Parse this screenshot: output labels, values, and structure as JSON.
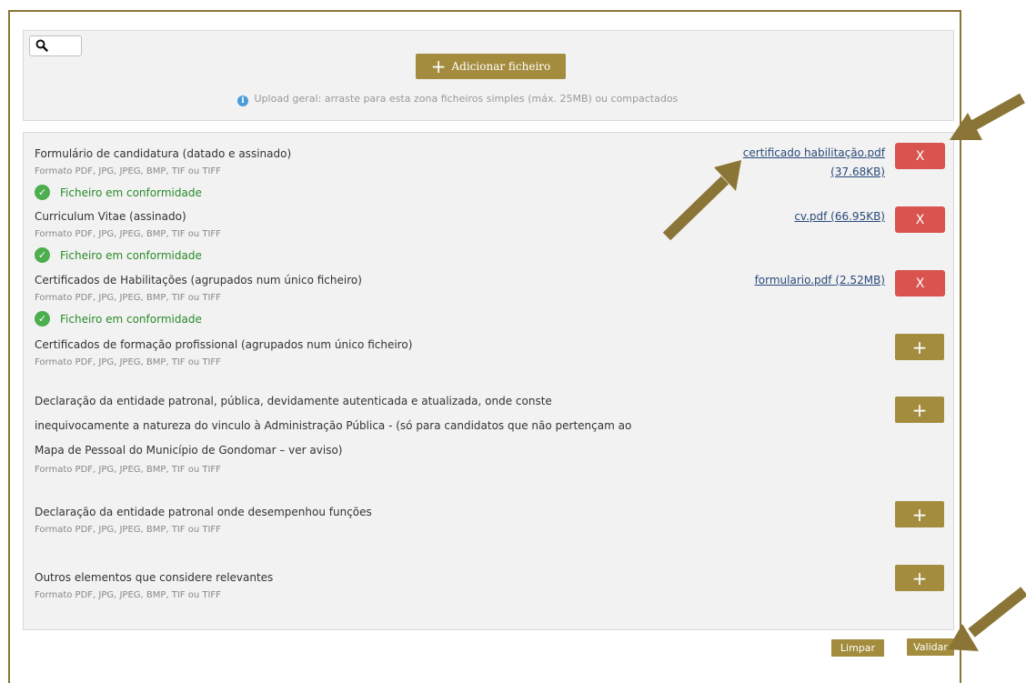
{
  "upload": {
    "add_file_label": "Adicionar ficheiro",
    "info_text": "Upload geral: arraste para esta zona ficheiros simples (máx. 25MB) ou compactados"
  },
  "documents": [
    {
      "label": "Formulário de candidatura (datado e assinado)",
      "format": "Formato PDF, JPG, JPEG, BMP, TIF ou TIFF",
      "file_name": "certificado habilitação.pdf",
      "file_size": "(37.68KB)",
      "status": "Ficheiro em conformidade",
      "delete_label": "X"
    },
    {
      "label": "Curriculum Vitae (assinado)",
      "format": "Formato PDF, JPG, JPEG, BMP, TIF ou TIFF",
      "file_link": "cv.pdf (66.95KB)",
      "status": "Ficheiro em conformidade",
      "delete_label": "X"
    },
    {
      "label": "Certificados de Habilitações (agrupados num único ficheiro)",
      "format": "Formato PDF, JPG, JPEG, BMP, TIF ou TIFF",
      "file_link": "formulario.pdf (2.52MB)",
      "status": "Ficheiro em conformidade",
      "delete_label": "X"
    },
    {
      "label": "Certificados de formação profissional (agrupados num único ficheiro)",
      "format": "Formato PDF, JPG, JPEG, BMP, TIF ou TIFF",
      "add_label": "+"
    },
    {
      "label_lines": [
        "Declaração da entidade patronal, pública, devidamente autenticada e atualizada, onde conste",
        "inequivocamente a natureza do vinculo à Administração Pública - (só para candidatos que não pertençam ao",
        "Mapa de Pessoal do Município de Gondomar – ver aviso)"
      ],
      "format": "Formato PDF, JPG, JPEG, BMP, TIF ou TIFF",
      "add_label": "+"
    },
    {
      "label": "Declaração da entidade patronal onde desempenhou funções",
      "format": "Formato PDF, JPG, JPEG, BMP, TIF ou TIFF",
      "add_label": "+"
    },
    {
      "label": "Outros elementos que considere relevantes",
      "format": "Formato PDF, JPG, JPEG, BMP, TIF ou TIFF",
      "add_label": "+"
    }
  ],
  "actions": {
    "clear_label": "Limpar",
    "validate_label": "Validar"
  },
  "icons": {
    "search": "search-icon",
    "info": "info-icon",
    "check": "check-circle-icon",
    "plus": "plus-icon"
  },
  "colors": {
    "accent_gold": "#a48c3e",
    "danger_red": "#d9534f",
    "success_green": "#4cae4c",
    "info_blue": "#4a9bd9",
    "arrow_annotation": "#8a7536"
  }
}
